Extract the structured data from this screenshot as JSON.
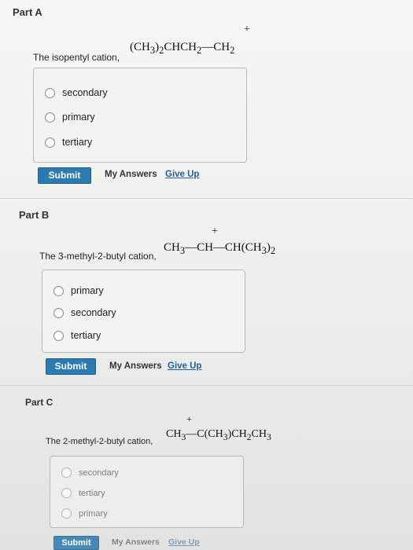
{
  "partA": {
    "title": "Part A",
    "prompt": "The isopentyl cation,",
    "formula_text": "(CH3)2CHCH2—CH2",
    "choices": [
      "secondary",
      "primary",
      "tertiary"
    ],
    "submit_label": "Submit",
    "my_answers_label": "My Answers",
    "give_up_label": "Give Up"
  },
  "partB": {
    "title": "Part B",
    "prompt": "The 3-methyl-2-butyl cation,",
    "formula_text": "CH3—CH—CH(CH3)2",
    "choices": [
      "primary",
      "secondary",
      "tertiary"
    ],
    "submit_label": "Submit",
    "my_answers_label": "My Answers",
    "give_up_label": "Give Up"
  },
  "partC": {
    "title": "Part C",
    "prompt": "The 2-methyl-2-butyl cation,",
    "formula_text": "CH3—C(CH3)CH2CH3",
    "choices": [
      "secondary",
      "tertiary",
      "primary"
    ],
    "submit_label": "Submit",
    "my_answers_label": "My Answers",
    "give_up_label": "Give Up"
  },
  "colors": {
    "submit_bg": "#2b7ab0",
    "link": "#1f5f9e"
  },
  "icons": {
    "radio": "radio-button-icon",
    "charge": "plus-charge"
  }
}
